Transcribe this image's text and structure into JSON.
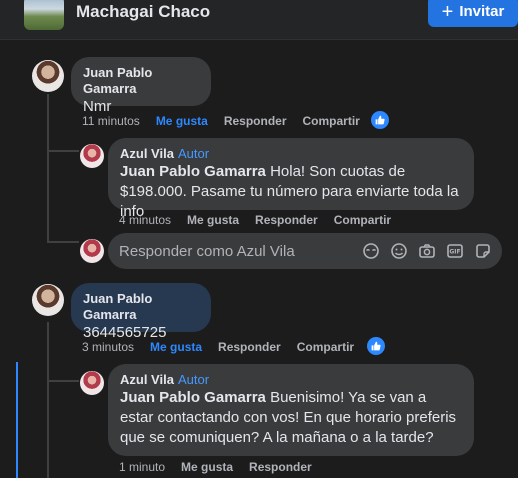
{
  "header": {
    "group_name": "Machagai Chaco",
    "join_label": "Invitar",
    "join_icon": "+"
  },
  "comments": [
    {
      "author": "Juan Pablo Gamarra",
      "text": "Nmr",
      "actions": {
        "time": "11 minutos",
        "like": "Me gusta",
        "reply": "Responder",
        "share": "Compartir"
      },
      "reply": {
        "author": "Azul Vila",
        "badge": "Autor",
        "mention": "Juan Pablo Gamarra",
        "text": " Hola! Son cuotas de $198.000. Pasame tu número para enviarte toda la info",
        "actions": {
          "time": "4 minutos",
          "like": "Me gusta",
          "reply": "Responder",
          "share": "Compartir"
        }
      }
    },
    {
      "author": "Juan Pablo Gamarra",
      "text": "3644565725",
      "actions": {
        "time": "3 minutos",
        "like": "Me gusta",
        "reply": "Responder",
        "share": "Compartir"
      },
      "reply": {
        "author": "Azul Vila",
        "badge": "Autor",
        "mention": "Juan Pablo Gamarra",
        "text": " Buenisimo! Ya se van a estar contactando con vos! En que horario preferis que se comuniquen? A la mañana o a la tarde?",
        "actions": {
          "time": "1 minuto",
          "like": "Me gusta",
          "reply": "Responder"
        }
      }
    }
  ],
  "reply_box": {
    "placeholder": "Responder como Azul Vila",
    "icons": [
      "avatar-sticker-icon",
      "emoji-icon",
      "camera-icon",
      "gif-icon",
      "sticker-icon"
    ]
  },
  "colors": {
    "accent": "#2d88ff",
    "button": "#2374e1",
    "bubble": "#3a3b3c",
    "highlight_bubble": "#263951",
    "background": "#1c1c1d"
  }
}
